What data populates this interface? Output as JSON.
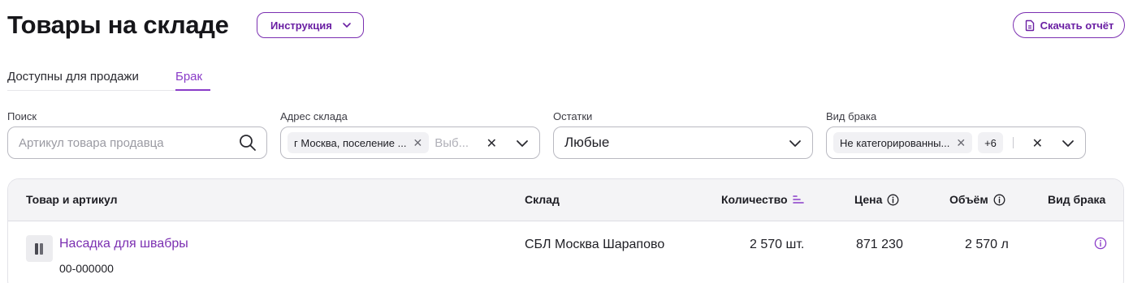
{
  "header": {
    "title": "Товары на складе",
    "instruction_label": "Инструкция",
    "download_label": "Скачать отчёт"
  },
  "tabs": [
    {
      "label": "Доступны для продажи",
      "active": false
    },
    {
      "label": "Брак",
      "active": true
    }
  ],
  "filters": {
    "search": {
      "label": "Поиск",
      "placeholder": "Артикул товара продавца"
    },
    "address": {
      "label": "Адрес склада",
      "chip": "г Москва, поселение ...",
      "placeholder": "Выб..."
    },
    "stock": {
      "label": "Остатки",
      "value": "Любые"
    },
    "defect_type": {
      "label": "Вид брака",
      "chip": "Не категорированны...",
      "more": "+6"
    }
  },
  "table": {
    "columns": [
      "Товар и артикул",
      "Склад",
      "Количество",
      "Цена",
      "Объём",
      "Вид брака"
    ],
    "rows": [
      {
        "name": "Насадка для швабры",
        "article": "00-000000",
        "warehouse": "СБЛ Москва Шарапово",
        "quantity": "2 570 шт.",
        "price": "871 230",
        "volume": "2 570 л"
      }
    ]
  },
  "colors": {
    "accent": "#7b2fb1",
    "tab_active": "#8a3cc8",
    "header_bg": "#f4f4f6"
  }
}
